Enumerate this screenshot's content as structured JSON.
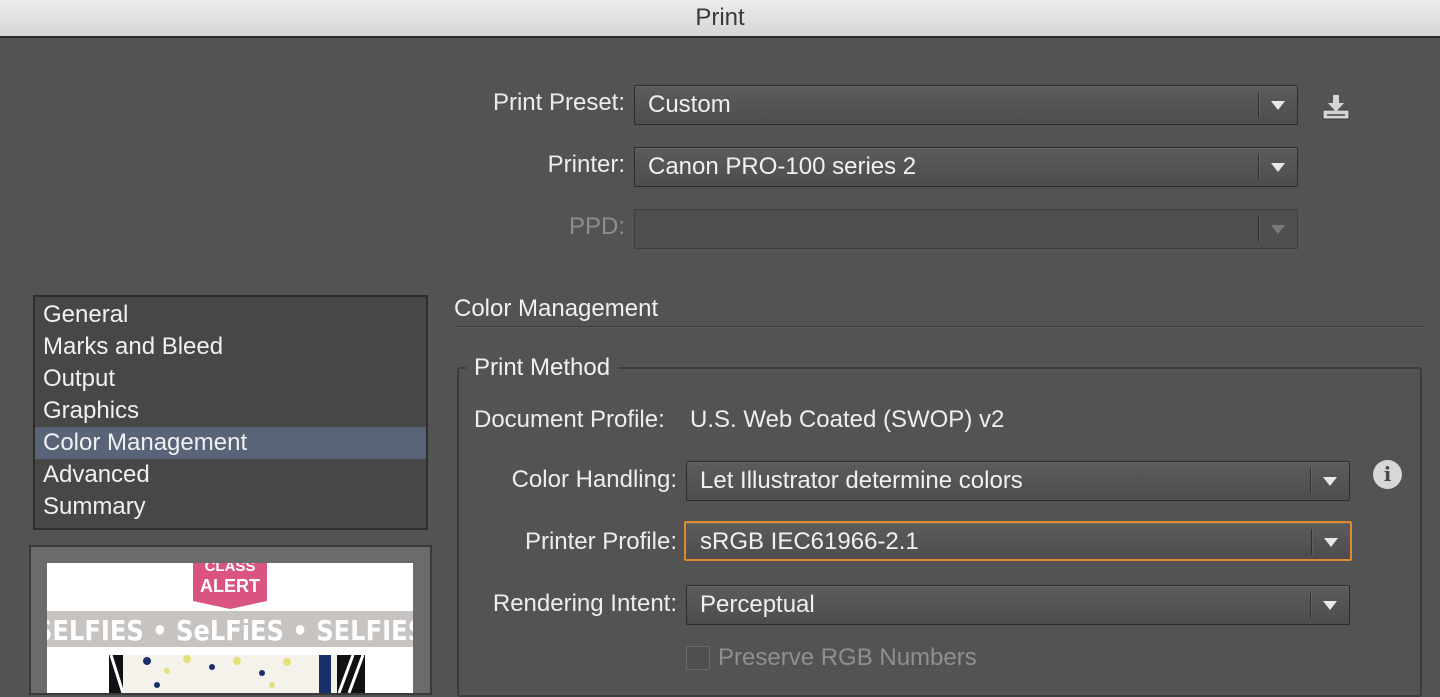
{
  "window": {
    "title": "Print"
  },
  "top_fields": {
    "print_preset": {
      "label": "Print Preset:",
      "value": "Custom"
    },
    "printer": {
      "label": "Printer:",
      "value": "Canon PRO-100 series 2"
    },
    "ppd": {
      "label": "PPD:",
      "value": ""
    }
  },
  "sidebar": {
    "items": [
      {
        "label": "General"
      },
      {
        "label": "Marks and Bleed"
      },
      {
        "label": "Output"
      },
      {
        "label": "Graphics"
      },
      {
        "label": "Color Management",
        "selected": true
      },
      {
        "label": "Advanced"
      },
      {
        "label": "Summary"
      }
    ]
  },
  "preview": {
    "banner_line1": "CLASS",
    "banner_line2": "ALERT",
    "strip_text": "SELFIES • SeLFiES • SELFIES"
  },
  "main": {
    "section_title": "Color Management",
    "group_title": "Print Method",
    "document_profile": {
      "label": "Document Profile:",
      "value": "U.S. Web Coated (SWOP) v2"
    },
    "color_handling": {
      "label": "Color Handling:",
      "value": "Let Illustrator determine colors"
    },
    "printer_profile": {
      "label": "Printer Profile:",
      "value": "sRGB IEC61966-2.1"
    },
    "rendering_intent": {
      "label": "Rendering Intent:",
      "value": "Perceptual"
    },
    "preserve_rgb": {
      "label": "Preserve RGB Numbers",
      "checked": false
    }
  },
  "icons": {
    "save_preset": "save-preset-icon",
    "info": "info-icon"
  },
  "colors": {
    "focus": "#e08a2c",
    "selection": "#5a6478",
    "banner": "#d9547e"
  }
}
